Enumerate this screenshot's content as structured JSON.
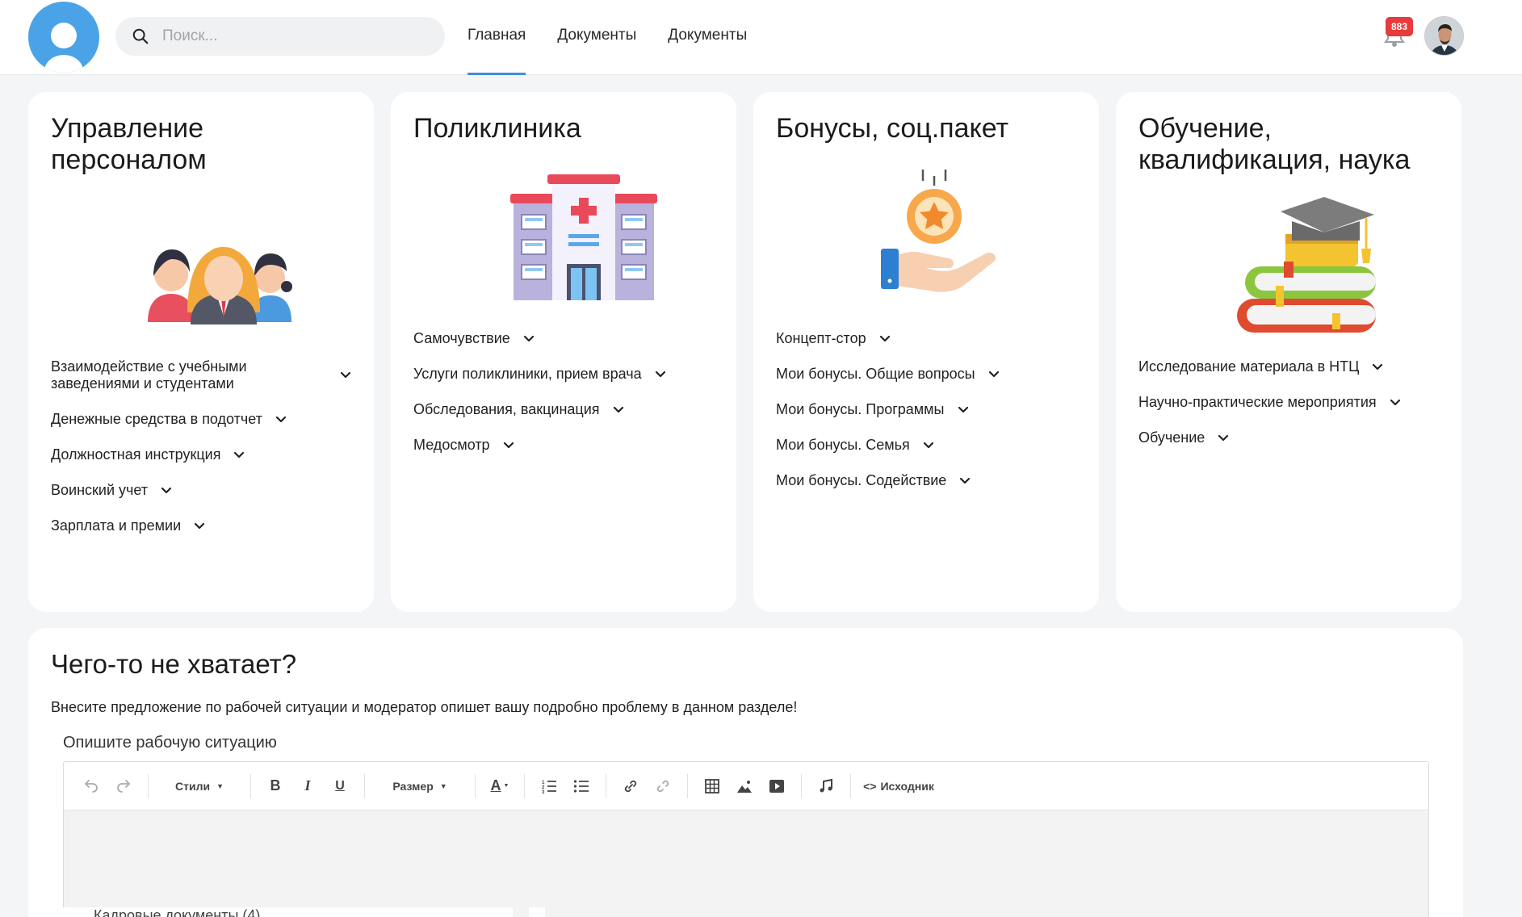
{
  "header": {
    "search_placeholder": "Поиск...",
    "nav": [
      "Главная",
      "Документы",
      "Документы"
    ],
    "notifications_count": "883"
  },
  "cards": [
    {
      "title": "Управление персоналом",
      "items": [
        "Взаимодействие с учебными заведениями и студентами",
        "Денежные средства в подотчет",
        "Должностная инструкция",
        "Воинский учет",
        "Зарплата и премии"
      ]
    },
    {
      "title": "Поликлиника",
      "items": [
        "Самочувствие",
        "Услуги поликлиники, прием врача",
        "Обследования, вакцинация",
        "Медосмотр"
      ]
    },
    {
      "title": "Бонусы, соц.пакет",
      "items": [
        "Концепт-стор",
        "Мои бонусы. Общие вопросы",
        "Мои бонусы. Программы",
        "Мои бонусы. Семья",
        "Мои бонусы. Содействие"
      ]
    },
    {
      "title": "Обучение, квалификация, наука",
      "items": [
        "Исследование материала в НТЦ",
        "Научно-практические мероприятия",
        "Обучение"
      ]
    }
  ],
  "suggest": {
    "title": "Чего-то не хватает?",
    "description": "Внесите предложение по рабочей ситуации и модератор опишет вашу подробно проблему в данном разделе!",
    "field_label": "Опишите рабочую ситуацию",
    "toolbar": {
      "styles": "Стили",
      "size": "Размер",
      "source": "Исходник"
    }
  },
  "behind_text": "Кадровые документы (4)"
}
